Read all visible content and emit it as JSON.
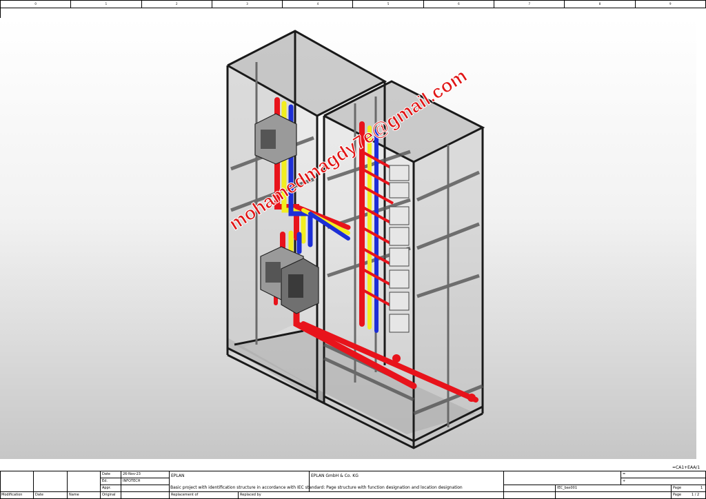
{
  "ruler": {
    "columns": [
      "0",
      "1",
      "2",
      "3",
      "4",
      "5",
      "6",
      "7",
      "8",
      "9"
    ]
  },
  "watermark": {
    "text": "mohamedmagdy7e@gmail.com"
  },
  "titleblock": {
    "location_code": "=CA1+EAA/1",
    "date_label": "Date",
    "date_value": "26-Nov-23",
    "ed_label": "Ed.",
    "ed_value": "INFOTECH",
    "appr_label": "Appr.",
    "original_label": "Original",
    "modification_label": "Modification",
    "col_date_label": "Date",
    "name_label": "Name",
    "company_short": "EPLAN",
    "company_full": "EPLAN GmbH & Co. KG",
    "description": "Basic project with identification structure in accordance with IEC standard: Page structure with function designation and location designation",
    "replacement_of_label": "Replacement of",
    "replaced_by_label": "Replaced by",
    "eq_symbol": "=",
    "plus_symbol": "+",
    "project_code": "IEC_bas001",
    "page_label": "Page",
    "page_value": "1",
    "page_label2": "Page",
    "page_total": "1 / 2"
  },
  "colors": {
    "phase_red": "#e8131b",
    "phase_yellow": "#f2ee1f",
    "phase_blue": "#1d2fd6",
    "frame": "#1a1a1a",
    "watermark": "#e01515"
  }
}
